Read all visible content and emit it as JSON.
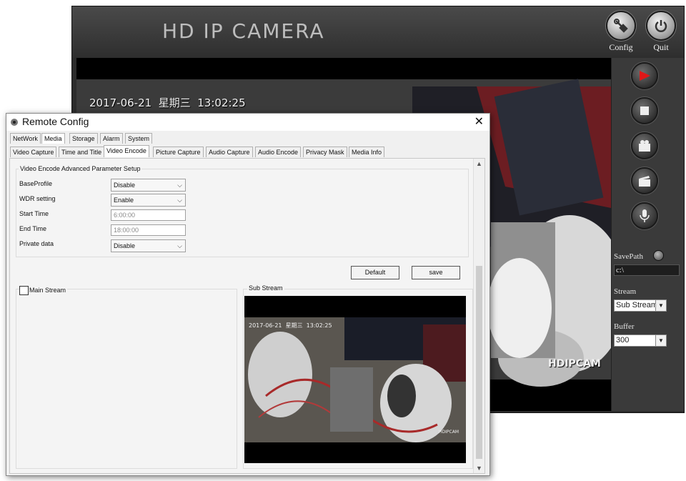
{
  "camera_window": {
    "title": "HD IP CAMERA",
    "config_label": "Config",
    "quit_label": "Quit",
    "osd_timestamp": "2017-06-21  星期三  13:02:25",
    "osd_watermark": "HDIPCAM",
    "side": {
      "savepath_label": "SavePath",
      "savepath_value": "c:\\",
      "stream_label": "Stream",
      "stream_value": "Sub Stream",
      "buffer_label": "Buffer",
      "buffer_value": "300"
    },
    "controls": [
      "play-icon",
      "stop-icon",
      "record-icon",
      "snapshot-icon",
      "microphone-icon"
    ]
  },
  "dialog": {
    "title": "Remote Config",
    "close_glyph": "✕",
    "top_tabs": [
      "NetWork",
      "Media",
      "Storage",
      "Alarm",
      "System"
    ],
    "sub_tabs": [
      "Video Capture",
      "Time and Title",
      "Video Encode",
      "Picture Capture",
      "Audio Capture",
      "Audio Encode",
      "Privacy Mask",
      "Media Info"
    ],
    "selected_top_tab": "Media",
    "selected_sub_tab": "Video Encode",
    "group_title": "Video Encode Advanced Parameter Setup",
    "fields": {
      "baseprofile_label": "BaseProfile",
      "baseprofile_value": "Disable",
      "wdr_label": "WDR setting",
      "wdr_value": "Enable",
      "start_label": "Start Time",
      "start_value": "6:00:00",
      "end_label": "End Time",
      "end_value": "18:00:00",
      "private_label": "Private data",
      "private_value": "Disable"
    },
    "default_button": "Default",
    "save_button": "save",
    "main_stream_label": "Main Stream",
    "main_stream_checked": false,
    "sub_stream_label": "Sub Stream",
    "sub_osd_timestamp": "2017-06-21  星期三  13:02:25",
    "sub_osd_watermark": "HDIPCAM"
  },
  "colors": {
    "play_red": "#e01818",
    "window_dark": "#2c2c2c"
  }
}
